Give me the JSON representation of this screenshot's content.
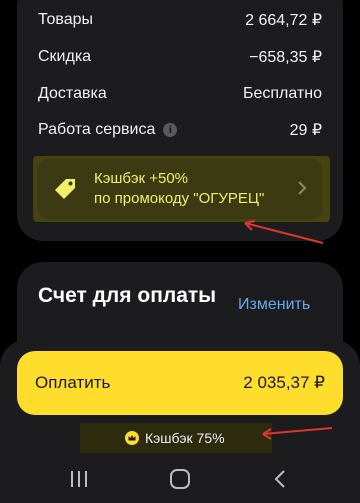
{
  "summary": {
    "rows": [
      {
        "label": "Товары",
        "value": "2 664,72 ₽"
      },
      {
        "label": "Скидка",
        "value": "−658,35 ₽"
      },
      {
        "label": "Доставка",
        "value": "Бесплатно"
      },
      {
        "label": "Работа сервиса",
        "value": "29 ₽",
        "info": "i"
      }
    ]
  },
  "promo": {
    "line1": "Кэшбэк +50%",
    "line2": "по промокоду \"ОГУРЕЦ\"",
    "icon": "price-tag-icon"
  },
  "billing": {
    "title": "Счет для оплаты",
    "change_label": "Изменить"
  },
  "pay": {
    "label": "Оплатить",
    "amount": "2 035,37 ₽"
  },
  "cashback": {
    "label": "Кэшбэк 75%",
    "icon": "crown-icon"
  },
  "colors": {
    "accent": "#ffdd2d",
    "promo_text": "#f4ef6a",
    "link": "#6aa6ee",
    "annotation_arrow": "#e0352f"
  }
}
